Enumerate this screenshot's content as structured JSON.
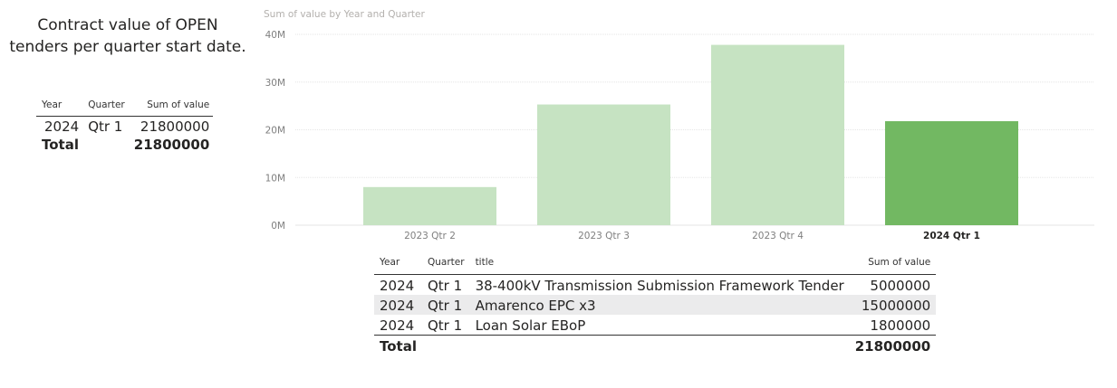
{
  "title": "Contract value of OPEN tenders per quarter start date.",
  "summary_table": {
    "headers": [
      "Year",
      "Quarter",
      "Sum of value"
    ],
    "rows": [
      [
        "2024",
        "Qtr 1",
        "21800000"
      ]
    ],
    "total_label": "Total",
    "total_value": "21800000"
  },
  "chart_data": {
    "type": "bar",
    "title": "Sum of value by Year and Quarter",
    "categories": [
      "2023 Qtr 2",
      "2023 Qtr 3",
      "2023 Qtr 4",
      "2024 Qtr 1"
    ],
    "values": [
      8000000,
      25300000,
      37800000,
      21800000
    ],
    "highlighted_category": "2024 Qtr 1",
    "ylim": [
      0,
      40000000
    ],
    "yticks": [
      "0M",
      "10M",
      "20M",
      "30M",
      "40M"
    ],
    "grid": true,
    "colors": {
      "bar": "#c6e3c2",
      "highlight": "#72b862"
    }
  },
  "detail_table": {
    "headers": [
      "Year",
      "Quarter",
      "title",
      "Sum of value"
    ],
    "rows": [
      [
        "2024",
        "Qtr 1",
        "38-400kV Transmission Submission Framework Tender",
        "5000000"
      ],
      [
        "2024",
        "Qtr 1",
        "Amarenco EPC x3",
        "15000000"
      ],
      [
        "2024",
        "Qtr 1",
        "Loan Solar EBoP",
        "1800000"
      ]
    ],
    "total_label": "Total",
    "total_value": "21800000"
  }
}
